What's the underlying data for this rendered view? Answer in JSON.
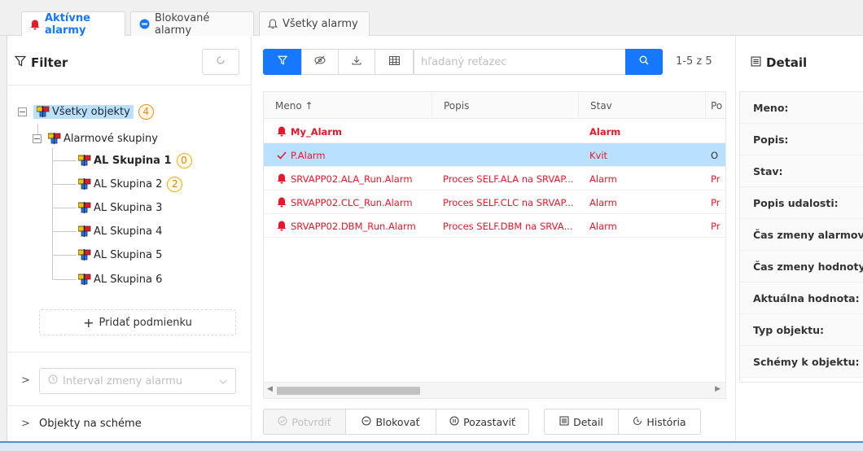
{
  "tabs": [
    {
      "label": "Aktívne alarmy",
      "icon": "bell-icon",
      "active": true
    },
    {
      "label": "Blokované alarmy",
      "icon": "blocked-icon",
      "active": false
    },
    {
      "label": "Všetky alarmy",
      "icon": "bell-outline-icon",
      "active": false
    }
  ],
  "filter": {
    "title": "Filter",
    "tree": {
      "root": {
        "label": "Všetky objekty",
        "count": "4"
      },
      "group": {
        "label": "Alarmové skupiny"
      },
      "items": [
        {
          "label": "AL Skupina 1",
          "count": "0"
        },
        {
          "label": "AL Skupina 2",
          "count": "2"
        },
        {
          "label": "AL Skupina 3"
        },
        {
          "label": "AL Skupina 4"
        },
        {
          "label": "AL Skupina 5"
        },
        {
          "label": "AL Skupina 6"
        }
      ]
    },
    "add_condition": "Pridať podmienku",
    "interval_placeholder": "Interval zmeny alarmu",
    "objects_on_scheme": "Objekty na schéme"
  },
  "toolbar": {
    "search_placeholder": "hľadaný reťazec",
    "counter": "1-5 z 5"
  },
  "table": {
    "columns": [
      "Meno ↑",
      "Popis",
      "Stav",
      "Po"
    ],
    "rows": [
      {
        "name": "My_Alarm",
        "desc": "",
        "state": "Alarm",
        "extra": ""
      },
      {
        "name": "P.Alarm",
        "desc": "",
        "state": "Kvit",
        "extra": "O"
      },
      {
        "name": "SRVAPP02.ALA_Run.Alarm",
        "desc": "Proces SELF.ALA na SRVAP...",
        "state": "Alarm",
        "extra": "Pr"
      },
      {
        "name": "SRVAPP02.CLC_Run.Alarm",
        "desc": "Proces SELF.CLC na SRVAP...",
        "state": "Alarm",
        "extra": "Pr"
      },
      {
        "name": "SRVAPP02.DBM_Run.Alarm",
        "desc": "Proces SELF.DBM na SRVA...",
        "state": "Alarm",
        "extra": "Pr"
      }
    ]
  },
  "actions": {
    "confirm": "Potvrdiť",
    "block": "Blokovať",
    "pause": "Pozastaviť",
    "detail": "Detail",
    "history": "História"
  },
  "detail": {
    "title": "Detail",
    "fields": [
      "Meno:",
      "Popis:",
      "Stav:",
      "Popis udalosti:",
      "Čas zmeny alarmove",
      "Čas zmeny hodnoty:",
      "Aktuálna hodnota:",
      "Typ objektu:",
      "Schémy k objektu:"
    ]
  },
  "colors": {
    "accent": "#1677ff",
    "alarm": "#e8182b",
    "selected_row": "#bae0ff"
  }
}
